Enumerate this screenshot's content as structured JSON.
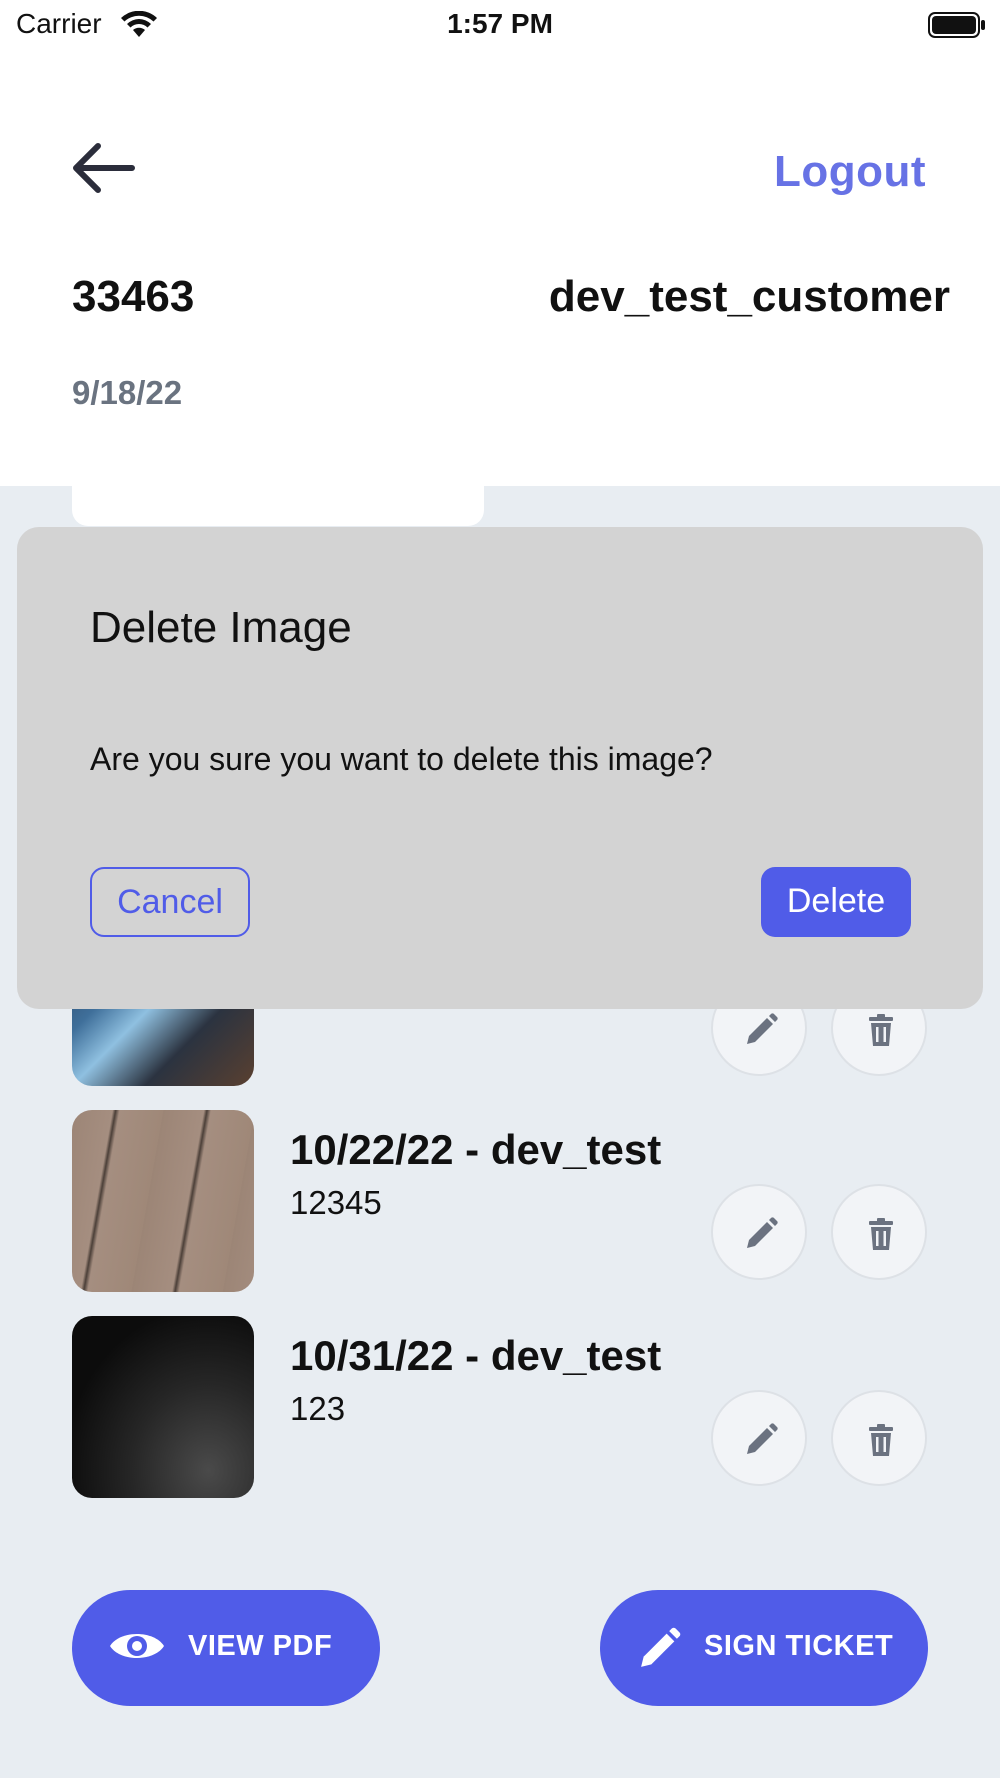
{
  "status_bar": {
    "carrier": "Carrier",
    "time": "1:57 PM"
  },
  "header": {
    "logout_label": "Logout",
    "ticket_id": "33463",
    "customer": "dev_test_customer",
    "date": "9/18/22"
  },
  "images": [
    {
      "title": "",
      "subtitle": ""
    },
    {
      "title": "10/22/22 - dev_test",
      "subtitle": "12345"
    },
    {
      "title": "10/31/22 - dev_test",
      "subtitle": "123"
    }
  ],
  "actions": {
    "view_pdf_label": "VIEW PDF",
    "sign_ticket_label": "SIGN TICKET"
  },
  "dialog": {
    "title": "Delete Image",
    "message": "Are you sure you want to delete this image?",
    "cancel_label": "Cancel",
    "delete_label": "Delete"
  },
  "colors": {
    "accent": "#505ce8",
    "logout": "#6772e5",
    "background": "#e8edf2",
    "dialog": "#d3d3d3"
  },
  "icons": {
    "back": "arrow-left-icon",
    "edit": "pencil-icon",
    "delete": "trash-icon",
    "view": "eye-icon",
    "sign": "pencil-icon"
  }
}
